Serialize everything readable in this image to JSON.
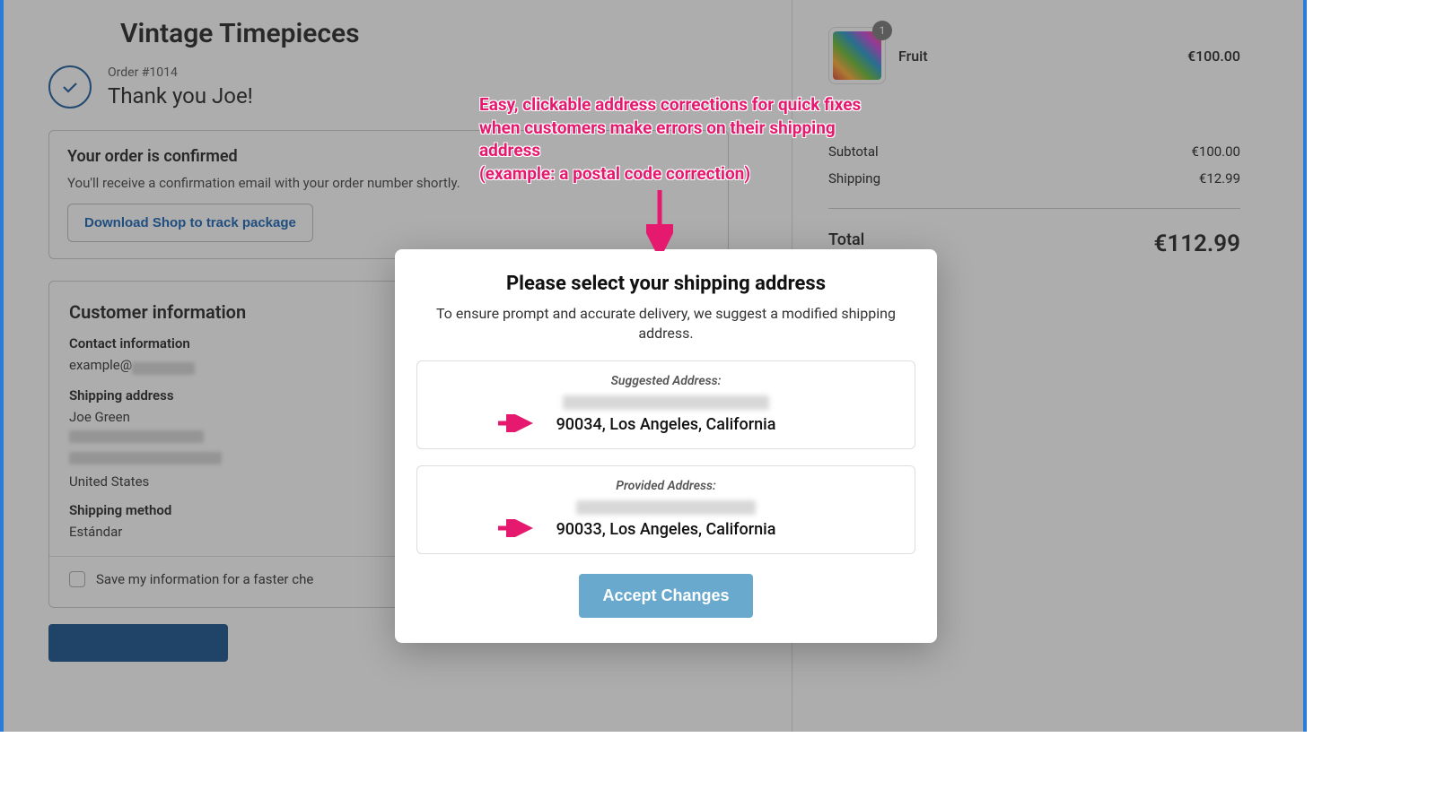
{
  "shop": {
    "name": "Vintage Timepieces"
  },
  "order": {
    "number": "Order #1014",
    "thank_you": "Thank you Joe!",
    "confirmed_title": "Your order is confirmed",
    "confirmed_sub": "You'll receive a confirmation email with your order number shortly.",
    "download_btn": "Download Shop to track package"
  },
  "customer": {
    "heading": "Customer information",
    "contact_label": "Contact information",
    "contact_value_prefix": "example@",
    "shipping_label": "Shipping address",
    "name": "Joe Green",
    "country": "United States",
    "method_label": "Shipping method",
    "method_value": "Estándar",
    "save_label": "Save my information for a faster che"
  },
  "cart": {
    "item": {
      "name": "Fruit",
      "qty": "1",
      "price": "€100.00"
    },
    "subtotal_label": "Subtotal",
    "subtotal_value": "€100.00",
    "shipping_label": "Shipping",
    "shipping_value": "€12.99",
    "total_label": "Total",
    "total_value": "€112.99"
  },
  "modal": {
    "title": "Please select your shipping address",
    "desc": "To ensure prompt and accurate delivery, we suggest a modified shipping address.",
    "suggested_label": "Suggested Address:",
    "suggested_line2": "90034, Los Angeles, California",
    "provided_label": "Provided Address:",
    "provided_line2": "90033, Los Angeles, California",
    "accept": "Accept Changes"
  },
  "annotation": {
    "text": "Easy, clickable address corrections for quick fixes when customers make errors on their shipping address\n(example: a postal code correction)"
  }
}
